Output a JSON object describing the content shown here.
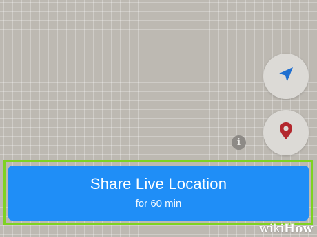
{
  "map": {
    "icons": {
      "navigate": "navigation-arrow-icon",
      "pin": "location-pin-icon",
      "info": "info-icon"
    },
    "info_glyph": "i"
  },
  "share_button": {
    "title": "Share Live Location",
    "subtitle": "for 60 min"
  },
  "watermark": {
    "prefix": "wiki",
    "suffix": "How"
  },
  "colors": {
    "accent_blue": "#1f8ef7",
    "nav_arrow": "#1f6fd0",
    "pin_red": "#b3272d",
    "highlight_green": "#7ed321",
    "map_background": "#bdb9b2"
  }
}
